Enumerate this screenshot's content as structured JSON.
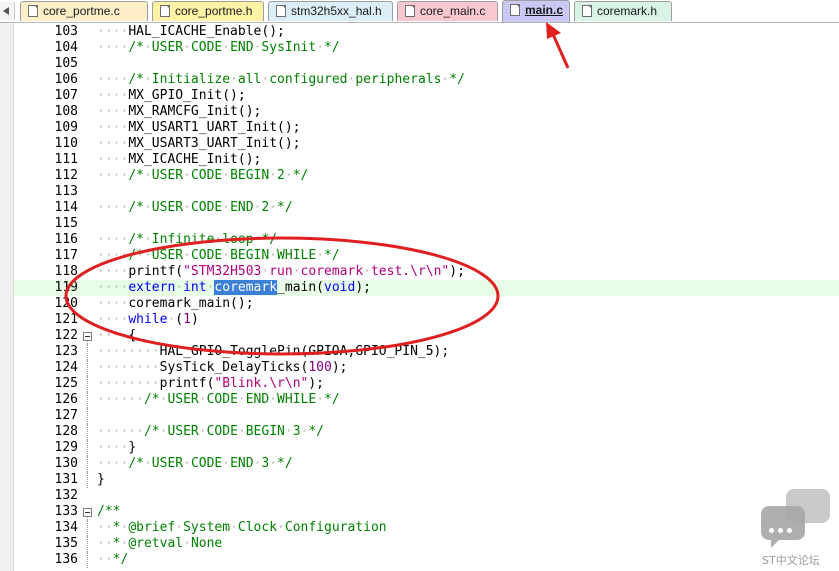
{
  "tabs": [
    {
      "label": "core_portme.c",
      "color": "#ffefc8",
      "active": false
    },
    {
      "label": "core_portme.h",
      "color": "#fdf2a6",
      "active": false
    },
    {
      "label": "stm32h5xx_hal.h",
      "color": "#dbeef7",
      "active": false
    },
    {
      "label": "core_main.c",
      "color": "#f7c8cf",
      "active": false
    },
    {
      "label": "main.c",
      "color": "#c9c9f4",
      "active": true
    },
    {
      "label": "coremark.h",
      "color": "#d8f2e6",
      "active": false
    }
  ],
  "editor": {
    "highlight_line": 119,
    "lines": [
      {
        "n": "103",
        "indent": "····",
        "parts": [
          [
            "plain",
            "HAL_ICACHE_Enable();"
          ]
        ]
      },
      {
        "n": "104",
        "indent": "····",
        "parts": [
          [
            "cm",
            "/*·USER·CODE·END·SysInit·*/"
          ]
        ]
      },
      {
        "n": "105",
        "indent": "",
        "parts": []
      },
      {
        "n": "106",
        "indent": "····",
        "parts": [
          [
            "cm",
            "/*·Initialize·all·configured·peripherals·*/"
          ]
        ]
      },
      {
        "n": "107",
        "indent": "····",
        "parts": [
          [
            "plain",
            "MX_GPIO_Init();"
          ]
        ]
      },
      {
        "n": "108",
        "indent": "····",
        "parts": [
          [
            "plain",
            "MX_RAMCFG_Init();"
          ]
        ]
      },
      {
        "n": "109",
        "indent": "····",
        "parts": [
          [
            "plain",
            "MX_USART1_UART_Init();"
          ]
        ]
      },
      {
        "n": "110",
        "indent": "····",
        "parts": [
          [
            "plain",
            "MX_USART3_UART_Init();"
          ]
        ]
      },
      {
        "n": "111",
        "indent": "····",
        "parts": [
          [
            "plain",
            "MX_ICACHE_Init();"
          ]
        ]
      },
      {
        "n": "112",
        "indent": "····",
        "parts": [
          [
            "cm",
            "/*·USER·CODE·BEGIN·2·*/"
          ]
        ]
      },
      {
        "n": "113",
        "indent": "",
        "parts": []
      },
      {
        "n": "114",
        "indent": "····",
        "parts": [
          [
            "cm",
            "/*·USER·CODE·END·2·*/"
          ]
        ]
      },
      {
        "n": "115",
        "indent": "",
        "parts": []
      },
      {
        "n": "116",
        "indent": "····",
        "parts": [
          [
            "cm",
            "/*·Infinite·loop·*/"
          ]
        ]
      },
      {
        "n": "117",
        "indent": "····",
        "parts": [
          [
            "cm",
            "/*·USER·CODE·BEGIN·WHILE·*/"
          ]
        ]
      },
      {
        "n": "118",
        "indent": "····",
        "parts": [
          [
            "plain",
            "printf("
          ],
          [
            "str",
            "\"STM32H503·run·coremark·test.\\r\\n\""
          ],
          [
            "plain",
            ");"
          ]
        ]
      },
      {
        "n": "119",
        "indent": "····",
        "parts": [
          [
            "kw",
            "extern·int·"
          ],
          [
            "sel",
            "coremark"
          ],
          [
            "plain",
            "_main("
          ],
          [
            "kw",
            "void"
          ],
          [
            "plain",
            ");"
          ]
        ]
      },
      {
        "n": "120",
        "indent": "····",
        "parts": [
          [
            "plain",
            "coremark_main();"
          ]
        ]
      },
      {
        "n": "121",
        "indent": "····",
        "parts": [
          [
            "kw",
            "while"
          ],
          [
            "plain",
            "·("
          ],
          [
            "num",
            "1"
          ],
          [
            "plain",
            ")"
          ]
        ]
      },
      {
        "n": "122",
        "indent": "····",
        "parts": [
          [
            "plain",
            "{"
          ]
        ],
        "fold": "box"
      },
      {
        "n": "123",
        "indent": "········",
        "parts": [
          [
            "plain",
            "HAL_GPIO_TogglePin(GPIOA,GPIO_PIN_5);"
          ]
        ],
        "fold": "line"
      },
      {
        "n": "124",
        "indent": "········",
        "parts": [
          [
            "plain",
            "SysTick_DelayTicks("
          ],
          [
            "num",
            "100"
          ],
          [
            "plain",
            ");"
          ]
        ],
        "fold": "line"
      },
      {
        "n": "125",
        "indent": "········",
        "parts": [
          [
            "plain",
            "printf("
          ],
          [
            "str",
            "\"Blink.\\r\\n\""
          ],
          [
            "plain",
            ");"
          ]
        ],
        "fold": "line"
      },
      {
        "n": "126",
        "indent": "······",
        "parts": [
          [
            "cm",
            "/*·USER·CODE·END·WHILE·*/"
          ]
        ],
        "fold": "line"
      },
      {
        "n": "127",
        "indent": "",
        "parts": [],
        "fold": "line"
      },
      {
        "n": "128",
        "indent": "······",
        "parts": [
          [
            "cm",
            "/*·USER·CODE·BEGIN·3·*/"
          ]
        ],
        "fold": "line"
      },
      {
        "n": "129",
        "indent": "····",
        "parts": [
          [
            "plain",
            "}"
          ]
        ],
        "fold": "line"
      },
      {
        "n": "130",
        "indent": "····",
        "parts": [
          [
            "cm",
            "/*·USER·CODE·END·3·*/"
          ]
        ],
        "fold": "line"
      },
      {
        "n": "131",
        "indent": "",
        "parts": [
          [
            "plain",
            "}"
          ]
        ],
        "fold": "line"
      },
      {
        "n": "132",
        "indent": "",
        "parts": []
      },
      {
        "n": "133",
        "indent": "",
        "parts": [
          [
            "cm",
            "/**"
          ]
        ],
        "fold": "box"
      },
      {
        "n": "134",
        "indent": "··",
        "parts": [
          [
            "cm",
            "*·@brief·System·Clock·Configuration"
          ]
        ],
        "fold": "line"
      },
      {
        "n": "135",
        "indent": "··",
        "parts": [
          [
            "cm",
            "*·@retval·None"
          ]
        ],
        "fold": "line"
      },
      {
        "n": "136",
        "indent": "··",
        "parts": [
          [
            "cm",
            "*/"
          ]
        ],
        "fold": "line"
      }
    ]
  },
  "watermark": {
    "text": "ST中文论坛"
  },
  "colors": {
    "comment": "#008000",
    "keyword": "#0000ff",
    "string": "#b0007d",
    "number": "#800080",
    "selection": "#3c7fd6",
    "line_highlight": "#e8fde8",
    "annotation_red": "#e02020"
  }
}
